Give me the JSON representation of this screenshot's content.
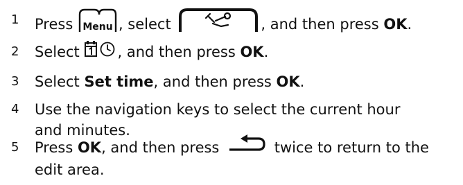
{
  "steps": [
    {
      "number": "1",
      "p1": "Press ",
      "p2": ", select ",
      "p3": ", and then press ",
      "ok": "OK",
      "p4": "."
    },
    {
      "number": "2",
      "p1": "Select ",
      "p2": ", and then press ",
      "ok": "OK",
      "p3": "."
    },
    {
      "number": "3",
      "p1": "Select ",
      "strong": "Set time",
      "p2": ", and then press ",
      "ok": "OK",
      "p3": "."
    },
    {
      "number": "4",
      "line1": "Use the navigation keys to select the current hour",
      "line2": "and minutes."
    },
    {
      "number": "5",
      "p1": "Press ",
      "ok": "OK",
      "p2": ", and then press ",
      "p3": " twice to return to the",
      "line2": "edit area."
    }
  ],
  "icons": {
    "menu_key_label": "Menu",
    "menu_key": "menu-softkey-icon",
    "settings_tab": "settings-wrench-tab-icon",
    "calendar": "calendar-icon",
    "clock": "clock-icon",
    "back": "back-arrow-icon"
  }
}
